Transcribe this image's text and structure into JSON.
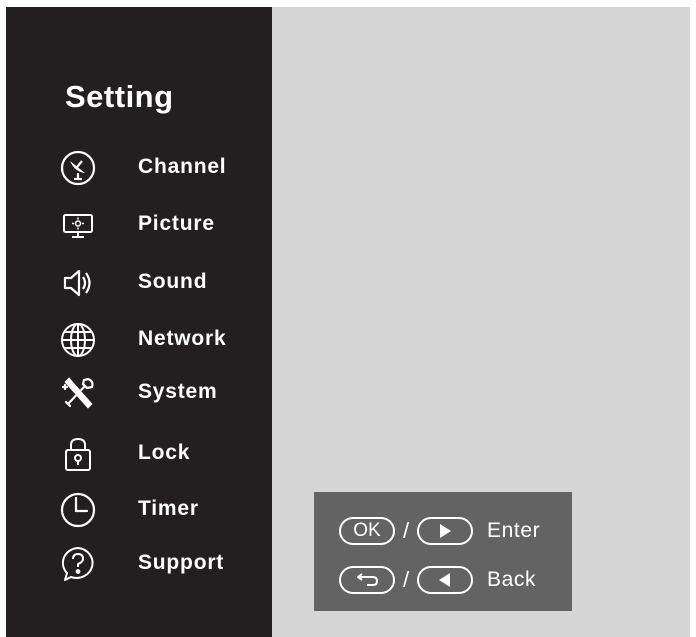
{
  "settings": {
    "title": "Setting",
    "menu": [
      {
        "icon": "satellite-dish-icon",
        "label": "Channel"
      },
      {
        "icon": "monitor-icon",
        "label": "Picture"
      },
      {
        "icon": "speaker-icon",
        "label": "Sound"
      },
      {
        "icon": "globe-icon",
        "label": "Network"
      },
      {
        "icon": "tools-icon",
        "label": "System"
      },
      {
        "icon": "padlock-icon",
        "label": "Lock"
      },
      {
        "icon": "clock-icon",
        "label": "Timer"
      },
      {
        "icon": "question-bubble-icon",
        "label": "Support"
      }
    ]
  },
  "hints": {
    "enter": {
      "key1": "OK",
      "key1_icon": "ok-button",
      "key2_icon": "right-arrow-icon",
      "label": "Enter"
    },
    "back": {
      "key1_icon": "return-arrow-icon",
      "key2_icon": "left-arrow-icon",
      "label": "Back"
    },
    "separator": "/"
  },
  "colors": {
    "sidebar_bg": "#231f20",
    "content_bg": "#d6d6d6",
    "hint_box_bg": "#636363",
    "text": "#ffffff"
  }
}
